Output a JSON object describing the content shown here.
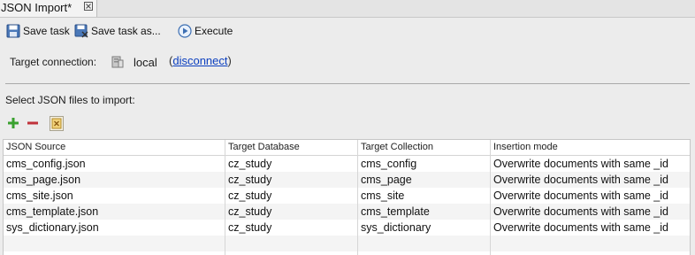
{
  "tab": {
    "title": "JSON Import*"
  },
  "toolbar": {
    "save_task": "Save task",
    "save_task_as": "Save task as...",
    "execute": "Execute"
  },
  "connection": {
    "label": "Target connection:",
    "name": "local",
    "open_paren": "(",
    "disconnect": "disconnect",
    "close_paren": ")"
  },
  "files": {
    "label": "Select JSON files to import:"
  },
  "table": {
    "columns": [
      "JSON Source",
      "Target Database",
      "Target Collection",
      "Insertion mode"
    ],
    "rows": [
      [
        "cms_config.json",
        "cz_study",
        "cms_config",
        "Overwrite documents with same _id"
      ],
      [
        "cms_page.json",
        "cz_study",
        "cms_page",
        "Overwrite documents with same _id"
      ],
      [
        "cms_site.json",
        "cz_study",
        "cms_site",
        "Overwrite documents with same _id"
      ],
      [
        "cms_template.json",
        "cz_study",
        "cms_template",
        "Overwrite documents with same _id"
      ],
      [
        "sys_dictionary.json",
        "cz_study",
        "sys_dictionary",
        "Overwrite documents with same _id"
      ]
    ]
  },
  "colors": {
    "link": "#0b3fbf",
    "add": "#3aa12f",
    "remove": "#c0323a"
  }
}
